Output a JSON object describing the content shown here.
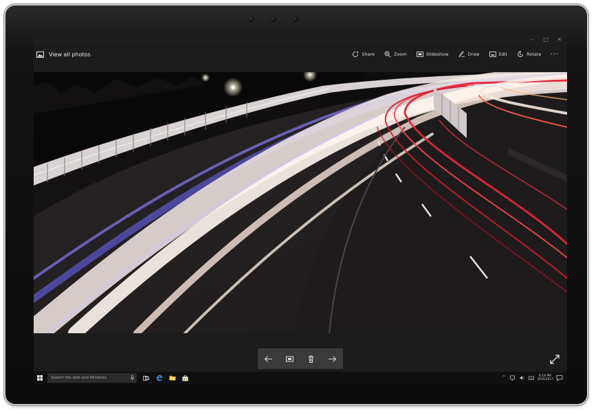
{
  "window": {
    "controls": {
      "minimize": "–",
      "maximize": "□",
      "close": "✕"
    }
  },
  "appbar": {
    "back_label": "View all photos",
    "commands": [
      {
        "label": "Share",
        "icon": "share-icon"
      },
      {
        "label": "Zoom",
        "icon": "zoom-icon"
      },
      {
        "label": "Slideshow",
        "icon": "slideshow-icon"
      },
      {
        "label": "Draw",
        "icon": "draw-icon"
      },
      {
        "label": "Edit",
        "icon": "edit-icon"
      },
      {
        "label": "Rotate",
        "icon": "rotate-icon"
      }
    ],
    "more": "···"
  },
  "photo": {
    "subject": "night highway light trails"
  },
  "navigation": {
    "buttons": [
      "previous-arrow-icon",
      "slideshow-icon",
      "delete-icon",
      "next-arrow-icon"
    ],
    "fullscreen_icon": "expand-icon"
  },
  "taskbar": {
    "search_placeholder": "Search the web and Windows",
    "pinned": [
      "task-view-icon",
      "edge-icon",
      "file-explorer-icon",
      "store-icon"
    ],
    "tray": {
      "chevron": "^",
      "time": "6:18 PM",
      "date": "8/16/2017"
    }
  },
  "colors": {
    "frame": "#0c0c0c",
    "appbar": "#1c1c1c",
    "taskbar": "#101010",
    "edge_blue": "#3a8ee6",
    "explorer_yellow": "#e8c34a"
  }
}
